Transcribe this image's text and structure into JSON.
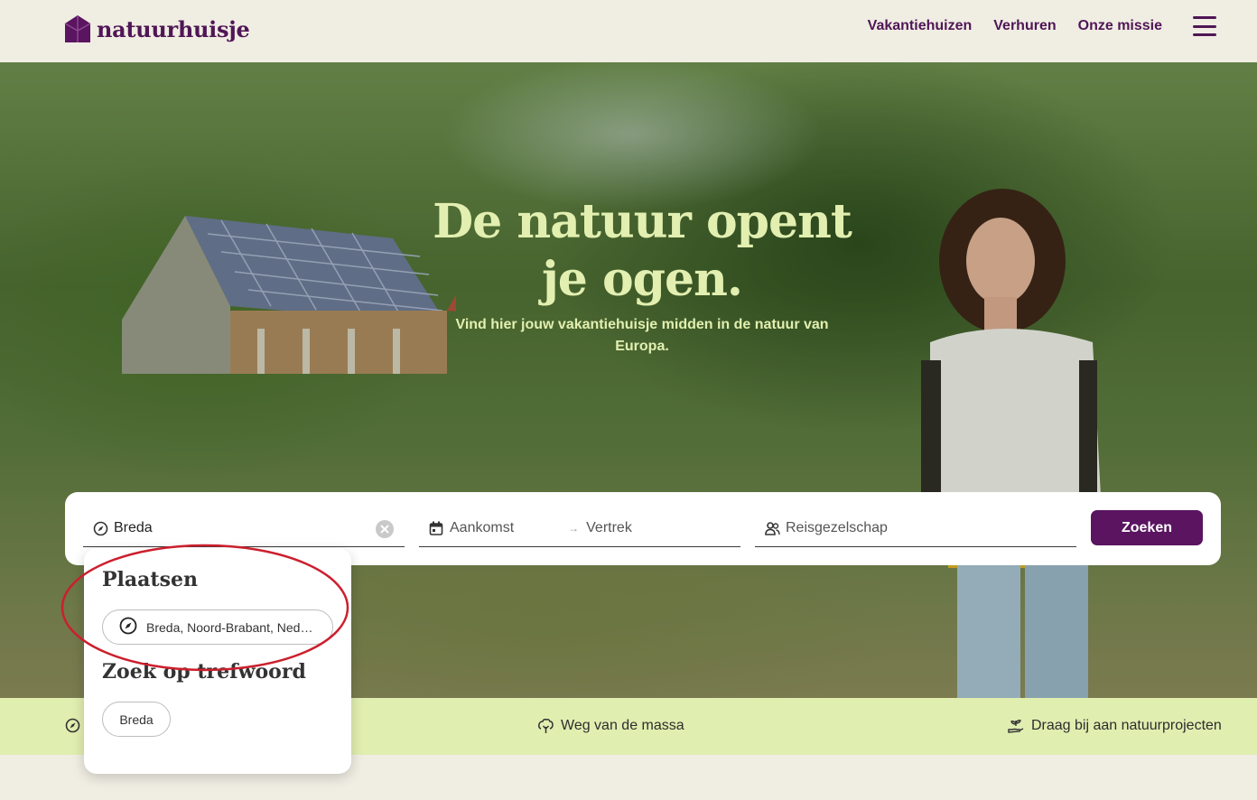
{
  "header": {
    "logo_text": "natuurhuisje",
    "nav": [
      {
        "label": "Vakantiehuizen"
      },
      {
        "label": "Verhuren"
      },
      {
        "label": "Onze missie"
      }
    ]
  },
  "hero": {
    "title": "De natuur opent je ogen.",
    "subtitle": "Vind hier jouw vakantiehuisje midden in de natuur van Europa."
  },
  "search": {
    "location_value": "Breda",
    "arrival_placeholder": "Aankomst",
    "departure_placeholder": "Vertrek",
    "guests_placeholder": "Reisgezelschap",
    "button_label": "Zoeken"
  },
  "dropdown": {
    "places_heading": "Plaatsen",
    "place_suggestion": "Breda, Noord-Brabant, Nederland",
    "keyword_heading": "Zoek op trefwoord",
    "keyword_suggestion": "Breda"
  },
  "features": [
    {
      "label": "Weg van de massa",
      "icon": "tree-icon"
    },
    {
      "label": "Draag bij aan natuurprojecten",
      "icon": "hand-plant-icon"
    }
  ],
  "colors": {
    "brand": "#5a1460",
    "hero_text": "#e2efb0",
    "strip_bg": "#e0eeb0",
    "annotation": "#cc1f2d"
  }
}
